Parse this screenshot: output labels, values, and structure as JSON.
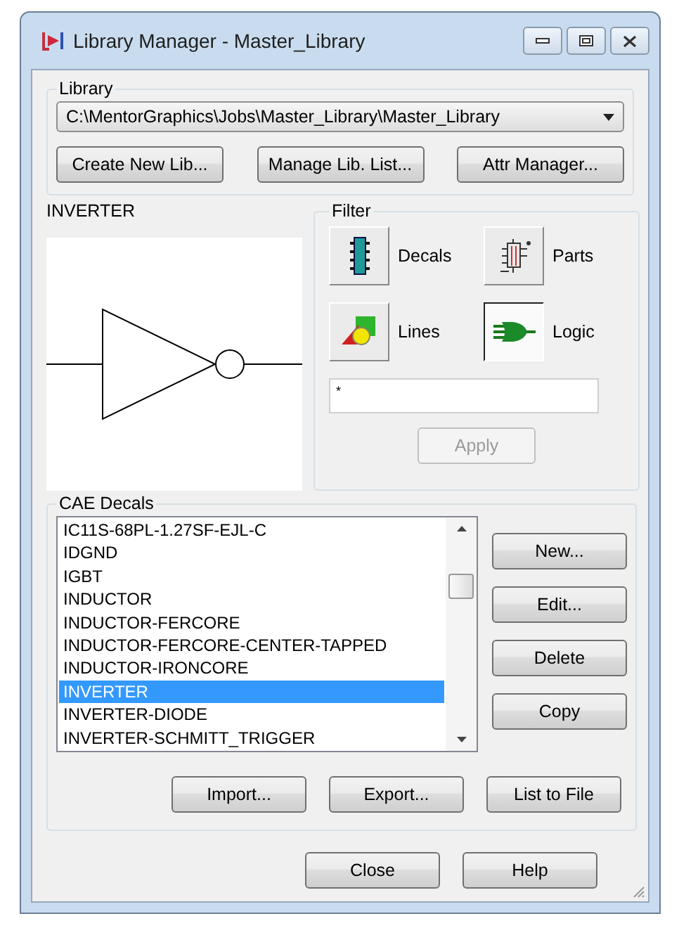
{
  "window": {
    "title": "Library Manager - Master_Library"
  },
  "library": {
    "label": "Library",
    "path": "C:\\MentorGraphics\\Jobs\\Master_Library\\Master_Library",
    "buttons": [
      "Create New Lib...",
      "Manage Lib. List...",
      "Attr Manager..."
    ]
  },
  "preview": {
    "label": "INVERTER"
  },
  "filter": {
    "label": "Filter",
    "options": [
      {
        "kind": "decals",
        "label": "Decals",
        "selected": false
      },
      {
        "kind": "parts",
        "label": "Parts",
        "selected": false
      },
      {
        "kind": "lines",
        "label": "Lines",
        "selected": false
      },
      {
        "kind": "logic",
        "label": "Logic",
        "selected": true
      }
    ],
    "pattern": "*",
    "apply": {
      "label": "Apply",
      "disabled": true
    }
  },
  "cae_decals": {
    "label": "CAE Decals",
    "items": [
      {
        "label": "IC11S-68PL-1.27SF-EJL-C",
        "selected": false
      },
      {
        "label": "IDGND",
        "selected": false
      },
      {
        "label": "IGBT",
        "selected": false
      },
      {
        "label": "INDUCTOR",
        "selected": false
      },
      {
        "label": "INDUCTOR-FERCORE",
        "selected": false
      },
      {
        "label": "INDUCTOR-FERCORE-CENTER-TAPPED",
        "selected": false
      },
      {
        "label": "INDUCTOR-IRONCORE",
        "selected": false
      },
      {
        "label": "INVERTER",
        "selected": true
      },
      {
        "label": "INVERTER-DIODE",
        "selected": false
      },
      {
        "label": "INVERTER-SCHMITT_TRIGGER",
        "selected": false
      }
    ],
    "side_buttons": [
      "New...",
      "Edit...",
      "Delete",
      "Copy"
    ],
    "bottom_buttons": [
      "Import...",
      "Export...",
      "List to File"
    ]
  },
  "buttons": [
    "Close",
    "Help"
  ]
}
